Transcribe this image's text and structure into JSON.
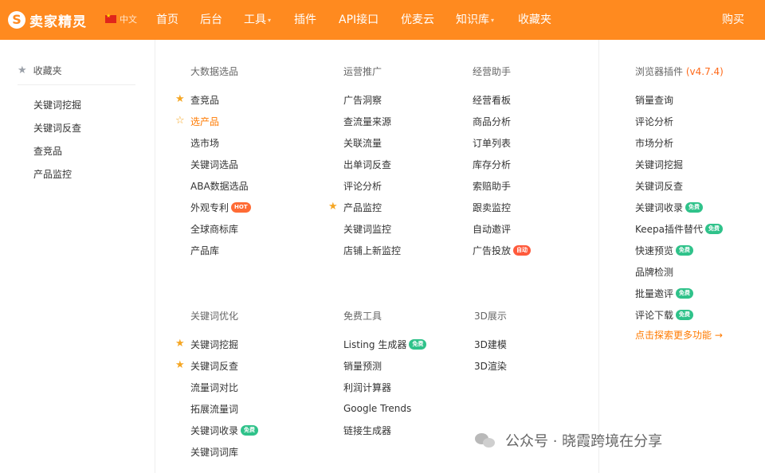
{
  "header": {
    "logo_mark": "S",
    "logo_text": "卖家精灵",
    "lang": "中文",
    "nav": [
      "首页",
      "后台",
      "工具",
      "插件",
      "API接口",
      "优麦云",
      "知识库",
      "收藏夹"
    ],
    "buy": "购买"
  },
  "favorites": {
    "title": "收藏夹",
    "items": [
      "关键词挖掘",
      "关键词反查",
      "查竞品",
      "产品监控"
    ]
  },
  "big_data": {
    "title": "大数据选品",
    "items": [
      "查竞品",
      "选产品",
      "选市场",
      "关键词选品",
      "ABA数据选品",
      "外观专利",
      "全球商标库",
      "产品库"
    ],
    "hot_badge": "HOT"
  },
  "ops_promo": {
    "title": "运营推广",
    "items": [
      "广告洞察",
      "查流量来源",
      "关联流量",
      "出单词反查",
      "评论分析",
      "产品监控",
      "关键词监控",
      "店铺上新监控"
    ]
  },
  "ops_assistant": {
    "title": "经营助手",
    "items": [
      "经营看板",
      "商品分析",
      "订单列表",
      "库存分析",
      "索赔助手",
      "跟卖监控",
      "自动邀评",
      "广告投放"
    ],
    "auto_badge": "自动"
  },
  "browser_plugin": {
    "title": "浏览器插件",
    "version": "(v4.7.4)",
    "items": [
      "销量查询",
      "评论分析",
      "市场分析",
      "关键词挖掘",
      "关键词反查",
      "关键词收录",
      "Keepa插件替代",
      "快速预览",
      "品牌检测",
      "批量邀评",
      "评论下载"
    ],
    "free_badge": "免费",
    "more": "点击探索更多功能 →"
  },
  "keyword_opt": {
    "title": "关键词优化",
    "items": [
      "关键词挖掘",
      "关键词反查",
      "流量词对比",
      "拓展流量词",
      "关键词收录",
      "关键词词库"
    ]
  },
  "free_tools": {
    "title": "免费工具",
    "items": [
      "Listing 生成器",
      "销量预测",
      "利润计算器",
      "Google Trends",
      "链接生成器"
    ]
  },
  "display_3d": {
    "title": "3D展示",
    "items": [
      "3D建模",
      "3D渲染"
    ]
  },
  "watermark": {
    "text": "公众号 · 晓霞跨境在分享"
  },
  "colors": {
    "brand": "#ff8a1f",
    "accent_text": "#ff7a00",
    "star": "#f5a623",
    "free_badge": "#2fc28a",
    "hot_badge": "#ff6b35"
  }
}
